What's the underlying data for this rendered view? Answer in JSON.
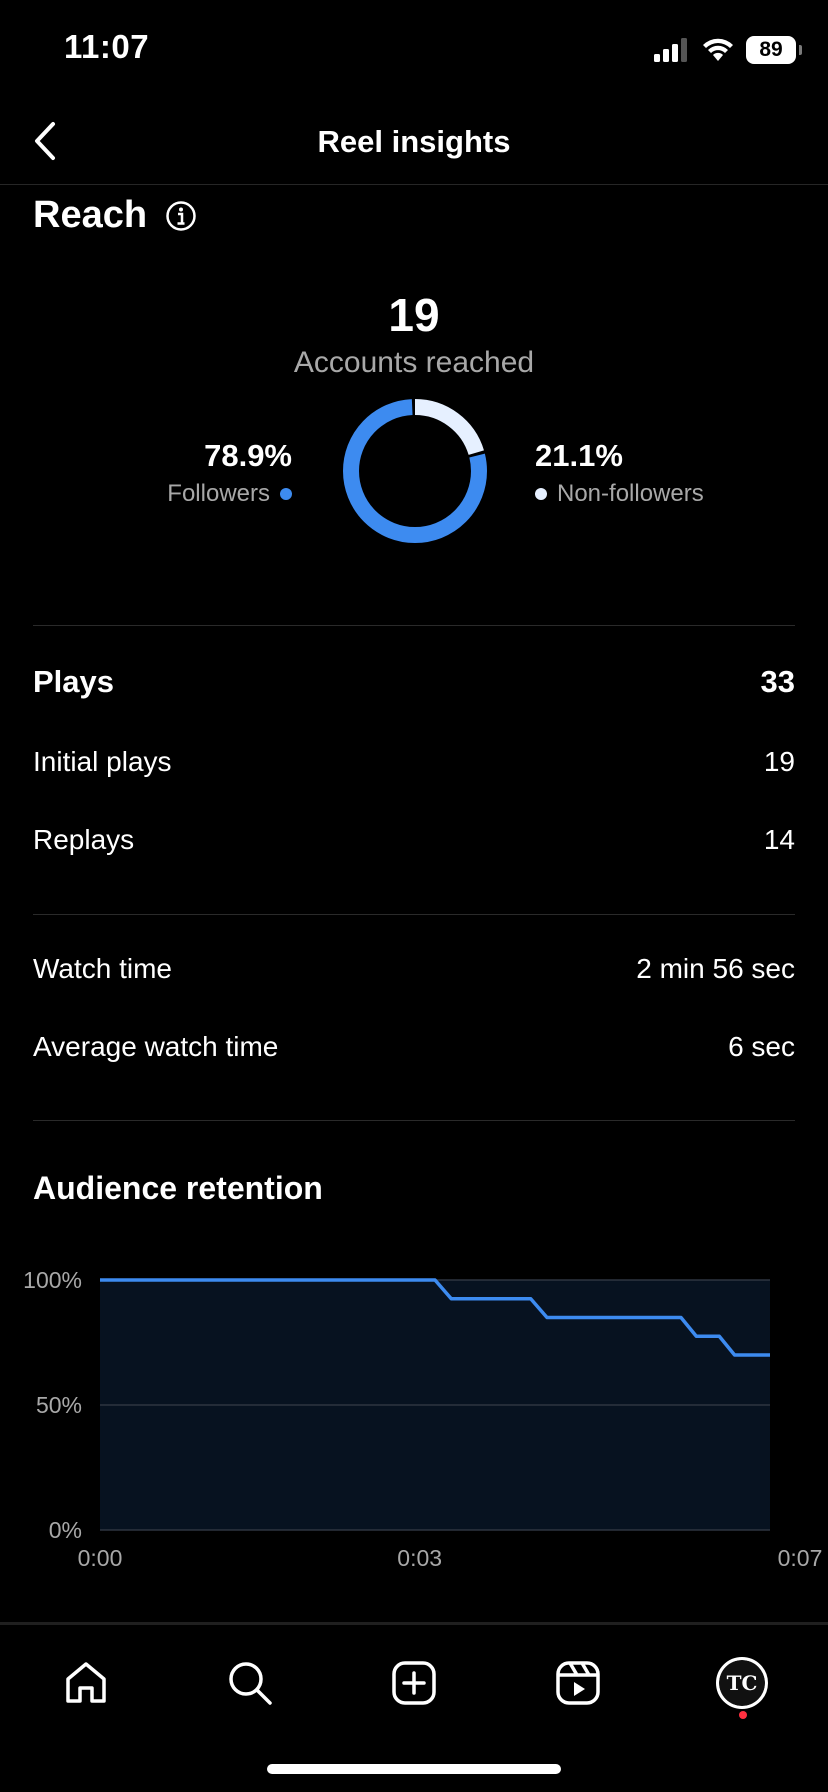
{
  "status_bar": {
    "time": "11:07",
    "battery": "89"
  },
  "header": {
    "title": "Reel insights"
  },
  "reach": {
    "title": "Reach",
    "count": "19",
    "count_label": "Accounts reached",
    "followers": {
      "percent": "78.9%",
      "label": "Followers",
      "value": 78.9,
      "color": "#3d8bf0"
    },
    "non_followers": {
      "percent": "21.1%",
      "label": "Non-followers",
      "value": 21.1,
      "color": "#e6f0ff"
    }
  },
  "plays": {
    "label": "Plays",
    "value": "33",
    "rows": [
      {
        "label": "Initial plays",
        "value": "19"
      },
      {
        "label": "Replays",
        "value": "14"
      }
    ]
  },
  "watch": {
    "rows": [
      {
        "label": "Watch time",
        "value": "2 min 56 sec"
      },
      {
        "label": "Average watch time",
        "value": "6 sec"
      }
    ]
  },
  "retention": {
    "title": "Audience retention"
  },
  "chart_data": {
    "type": "line",
    "title": "Audience retention",
    "x_tick_labels": [
      "0:00",
      "0:03",
      "0:07"
    ],
    "y_tick_labels": [
      "100%",
      "50%",
      "0%"
    ],
    "xlim": [
      0,
      7
    ],
    "ylim": [
      0,
      100
    ],
    "grid": true,
    "series": [
      {
        "x": [
          0,
          3.5,
          3.67,
          4.5,
          4.67,
          6.07,
          6.23,
          6.47,
          6.63,
          7
        ],
        "y": [
          100,
          100,
          92.5,
          92.5,
          85,
          85,
          77.5,
          77.5,
          70,
          70
        ],
        "color": "#3d8bf0"
      }
    ]
  },
  "tab_bar": {
    "items": [
      "home-icon",
      "search-icon",
      "create-icon",
      "reels-icon",
      "profile-avatar"
    ],
    "avatar_text": "TC"
  }
}
